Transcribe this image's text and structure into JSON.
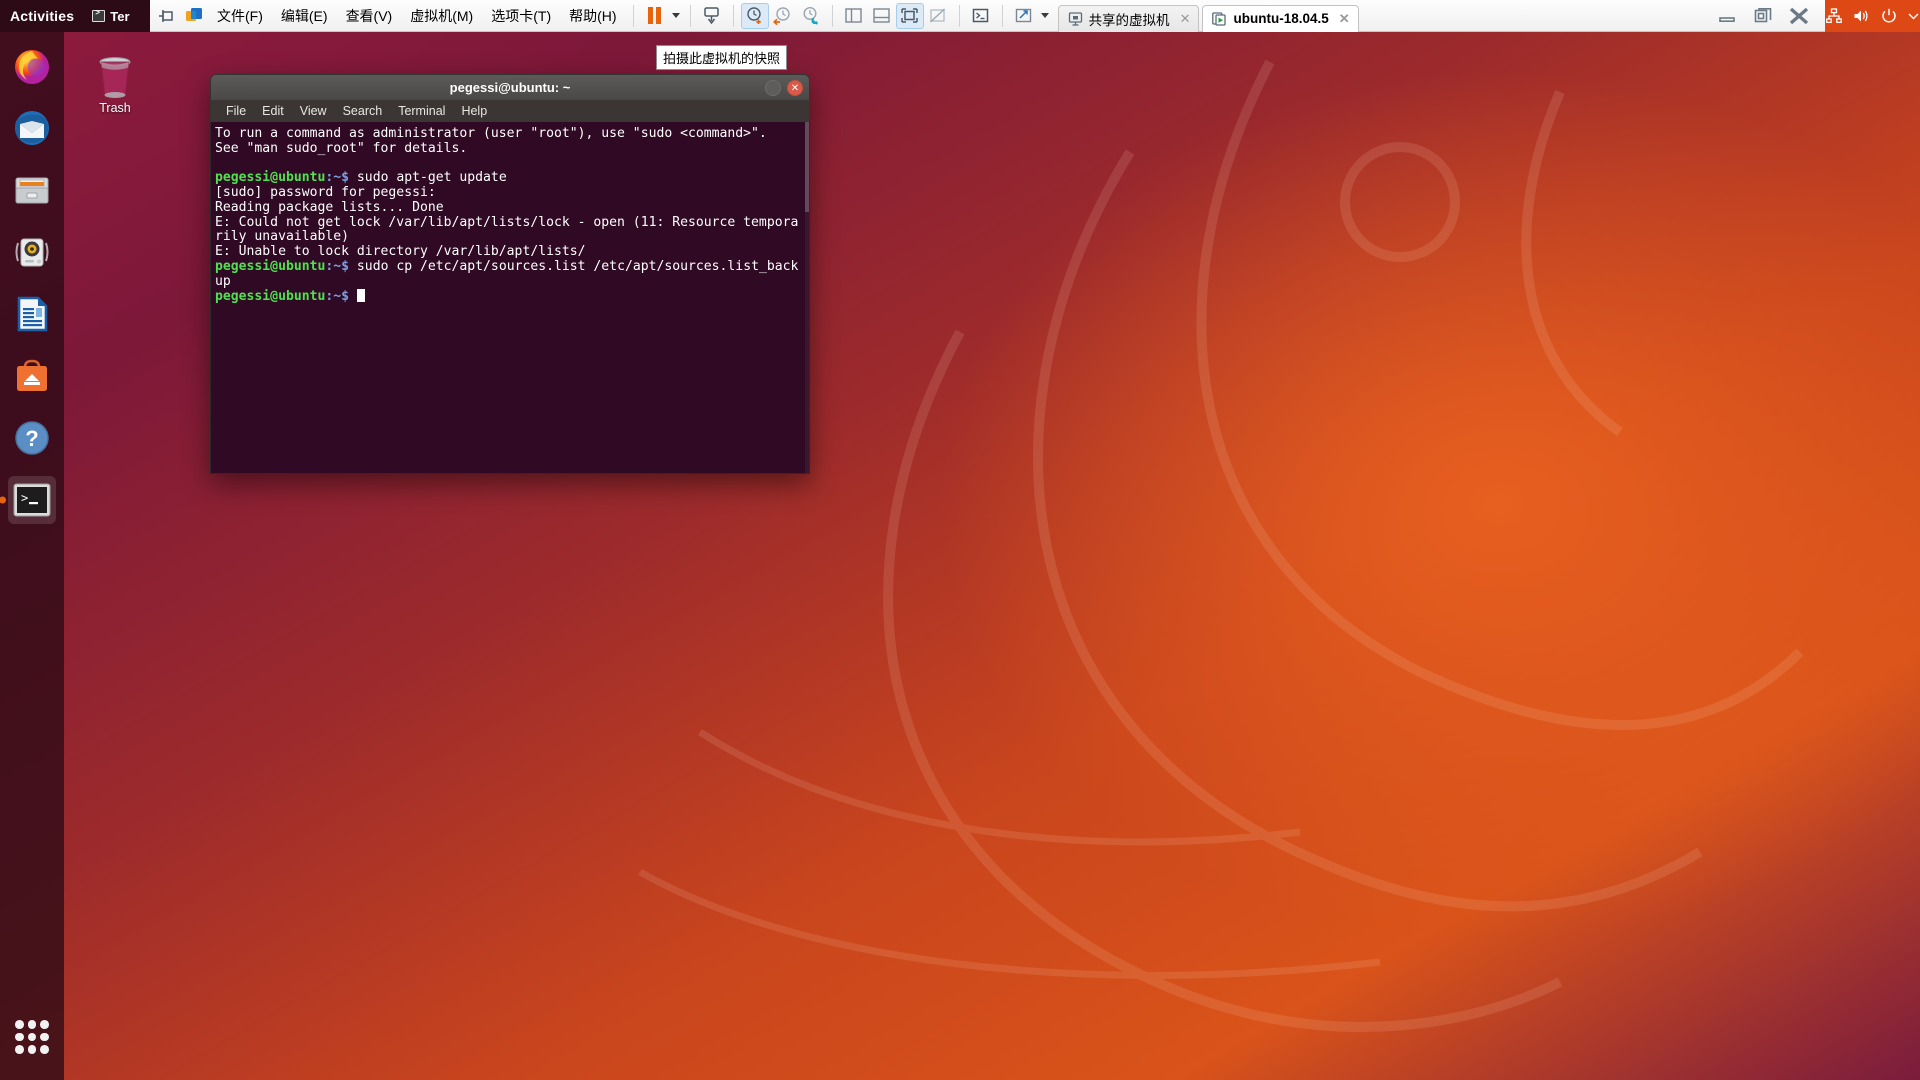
{
  "vmware": {
    "menu": [
      {
        "label": "文件(F)",
        "mnemonic": "F"
      },
      {
        "label": "编辑(E)",
        "mnemonic": "E"
      },
      {
        "label": "查看(V)",
        "mnemonic": "V"
      },
      {
        "label": "虚拟机(M)",
        "mnemonic": "M"
      },
      {
        "label": "选项卡(T)",
        "mnemonic": "T"
      },
      {
        "label": "帮助(H)",
        "mnemonic": "H"
      }
    ],
    "toolbar": [
      {
        "name": "pin-icon",
        "title": "固定"
      },
      {
        "name": "vmware-logo-icon",
        "title": "VMware"
      },
      {
        "name": "pause-icon",
        "title": "暂停"
      },
      {
        "name": "power-dropdown-caret-icon",
        "title": "电源"
      },
      {
        "name": "manage-icon",
        "title": "管理"
      },
      {
        "name": "snapshot-take-icon",
        "title": "拍摄此虚拟机的快照",
        "active": true
      },
      {
        "name": "snapshot-revert-icon",
        "title": "恢复快照"
      },
      {
        "name": "snapshot-manager-icon",
        "title": "快照管理器"
      },
      {
        "name": "library-panel-icon",
        "title": "显示或隐藏库"
      },
      {
        "name": "console-panel-icon",
        "title": "显示或隐藏控制台视图"
      },
      {
        "name": "fullscreen-icon",
        "title": "进入全屏",
        "active": true
      },
      {
        "name": "unity-icon",
        "title": "Unity 模式"
      },
      {
        "name": "terminal-icon",
        "title": "终端"
      },
      {
        "name": "stretch-icon",
        "title": "拉伸"
      },
      {
        "name": "stretch-caret-icon",
        "title": "拉伸选项"
      }
    ],
    "tabs": [
      {
        "label": "共享的虚拟机",
        "icon": "shared-vm-icon",
        "selected": false,
        "closable": true
      },
      {
        "label": "ubuntu-18.04.5",
        "icon": "running-vm-icon",
        "selected": true,
        "closable": true
      }
    ],
    "tooltip": "拍摄此虚拟机的快照",
    "window_controls": [
      {
        "name": "minimize-button",
        "glyph": "—"
      },
      {
        "name": "restore-button",
        "glyph": "❐"
      },
      {
        "name": "close-button",
        "glyph": "✕"
      }
    ]
  },
  "ubuntu": {
    "topbar": {
      "activities": "Activities",
      "app_name": "Ter",
      "tray": [
        "network-icon",
        "volume-icon",
        "power-icon",
        "tray-caret-icon"
      ]
    },
    "dock": {
      "items": [
        {
          "name": "dock-item-firefox",
          "label": "Firefox",
          "running": false
        },
        {
          "name": "dock-item-thunderbird",
          "label": "Thunderbird Mail",
          "running": false
        },
        {
          "name": "dock-item-files",
          "label": "Files",
          "running": false
        },
        {
          "name": "dock-item-rhythmbox",
          "label": "Rhythmbox",
          "running": false
        },
        {
          "name": "dock-item-libreoffice-writer",
          "label": "LibreOffice Writer",
          "running": false
        },
        {
          "name": "dock-item-ubuntu-software",
          "label": "Ubuntu Software",
          "running": false
        },
        {
          "name": "dock-item-help",
          "label": "Help",
          "running": false
        },
        {
          "name": "dock-item-terminal",
          "label": "Terminal",
          "running": true
        }
      ],
      "app_grid_label": "Show Applications"
    },
    "desktop_icons": [
      {
        "name": "desktop-icon-trash",
        "label": "Trash"
      }
    ]
  },
  "terminal": {
    "title": "pegessi@ubuntu: ~",
    "menu": [
      "File",
      "Edit",
      "View",
      "Search",
      "Terminal",
      "Help"
    ],
    "window_buttons": [
      {
        "name": "terminal-minimize-button",
        "glyph": ""
      },
      {
        "name": "terminal-close-button",
        "glyph": "✕"
      }
    ],
    "lines": [
      {
        "type": "plain",
        "text": "To run a command as administrator (user \"root\"), use \"sudo <command>\"."
      },
      {
        "type": "plain",
        "text": "See \"man sudo_root\" for details."
      },
      {
        "type": "plain",
        "text": ""
      },
      {
        "type": "prompt",
        "user": "pegessi@ubuntu",
        "path": ":~$ ",
        "cmd": "sudo apt-get update"
      },
      {
        "type": "plain",
        "text": "[sudo] password for pegessi:"
      },
      {
        "type": "plain",
        "text": "Reading package lists... Done"
      },
      {
        "type": "plain",
        "text": "E: Could not get lock /var/lib/apt/lists/lock - open (11: Resource temporarily unavailable)"
      },
      {
        "type": "plain",
        "text": "E: Unable to lock directory /var/lib/apt/lists/"
      },
      {
        "type": "prompt",
        "user": "pegessi@ubuntu",
        "path": ":~$ ",
        "cmd": "sudo cp /etc/apt/sources.list /etc/apt/sources.list_backup"
      },
      {
        "type": "prompt-cursor",
        "user": "pegessi@ubuntu",
        "path": ":~$ ",
        "cmd": ""
      }
    ]
  },
  "colors": {
    "ubuntu_orange": "#dd4814",
    "ubuntu_aubergine": "#2c001e",
    "terminal_bg": "#300a24",
    "prompt_green": "#4ee24e",
    "prompt_blue": "#7b9fe0",
    "toolbar_active": "#dceaf7"
  }
}
